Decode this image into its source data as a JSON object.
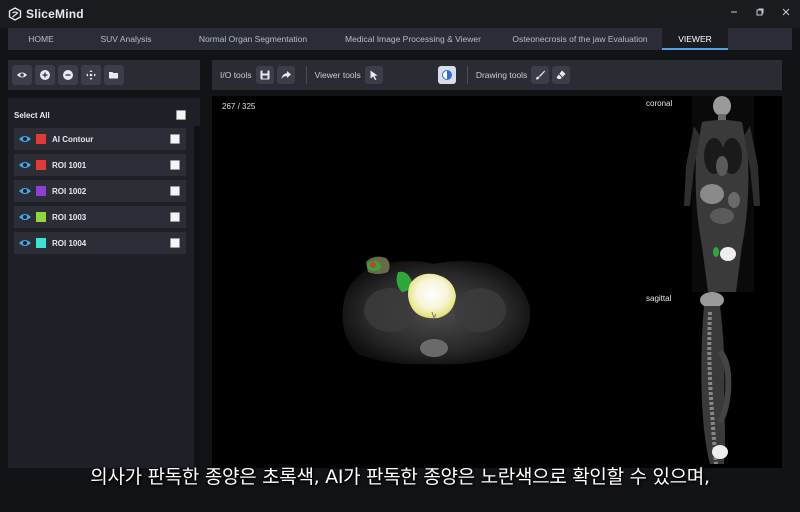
{
  "app": {
    "title": "SliceMind",
    "window_controls": [
      "minimize-icon",
      "restore-icon",
      "close-icon"
    ]
  },
  "tabs": [
    {
      "label": "HOME",
      "active": false
    },
    {
      "label": "SUV Analysis",
      "active": false
    },
    {
      "label": "Normal Organ Segmentation",
      "active": false
    },
    {
      "label": "Medical Image Processing & Viewer",
      "active": false
    },
    {
      "label": "Osteonecrosis of the jaw Evaluation",
      "active": false
    },
    {
      "label": "VIEWER",
      "active": true
    }
  ],
  "left_toolbar": {
    "icons": [
      "eye-icon",
      "add-icon",
      "remove-icon",
      "move-icon",
      "folder-open-icon"
    ]
  },
  "roi_panel": {
    "select_all_label": "Select All",
    "items": [
      {
        "label": "AI Contour",
        "color": "#e53935"
      },
      {
        "label": "ROI 1001",
        "color": "#e53935"
      },
      {
        "label": "ROI 1002",
        "color": "#8e3fd6"
      },
      {
        "label": "ROI 1003",
        "color": "#8fd63f"
      },
      {
        "label": "ROI 1004",
        "color": "#3fe0d6"
      }
    ]
  },
  "main_toolbar": {
    "io_label": "I/O tools",
    "viewer_label": "Viewer tools",
    "drawing_label": "Drawing tools"
  },
  "viewer": {
    "slice_counter": "267 / 325",
    "coronal_label": "coronal",
    "sagittal_label": "sagittal"
  },
  "subtitle": "의사가 판독한 종양은 초록색, AI가 판독한 종양은 노란색으로 확인할 수 있으며,",
  "colors": {
    "accent": "#4fa3e0",
    "tumor_ai": "#f4f08a",
    "tumor_doctor": "#2fa83a"
  }
}
